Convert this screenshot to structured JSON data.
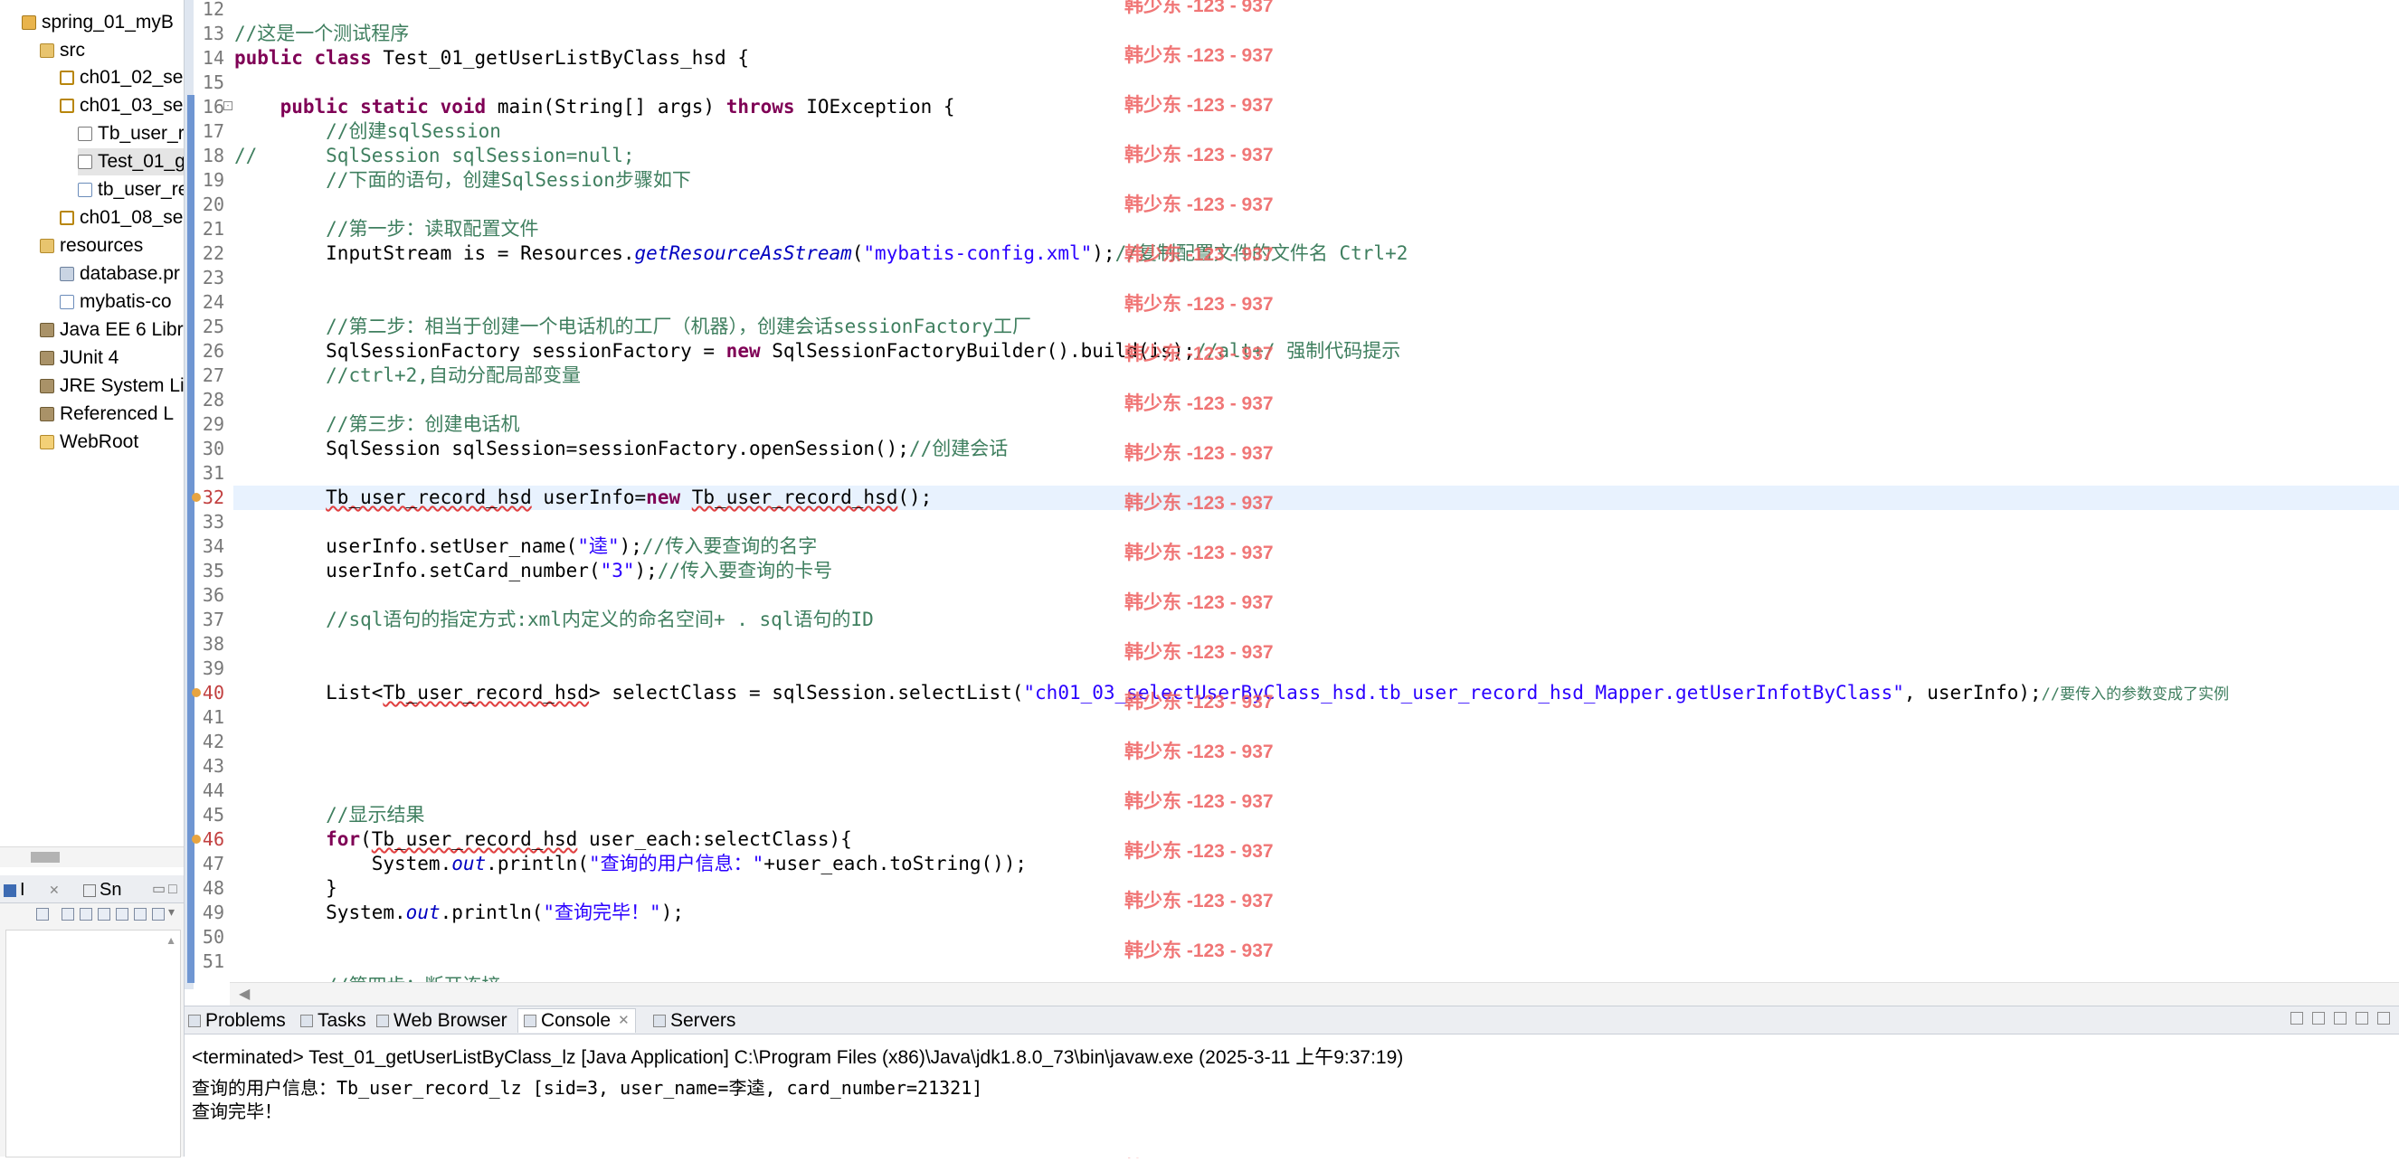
{
  "explorer": {
    "items": [
      {
        "label": "spring_01_myB",
        "icon": "project-icon"
      },
      {
        "label": "src",
        "icon": "folder-icon"
      },
      {
        "label": "ch01_02_se",
        "icon": "package-icon"
      },
      {
        "label": "ch01_03_se",
        "icon": "package-icon"
      },
      {
        "label": "Tb_user_r",
        "icon": "java-file-icon"
      },
      {
        "label": "Test_01_g",
        "icon": "java-file-icon"
      },
      {
        "label": "tb_user_re",
        "icon": "xml-file-icon"
      },
      {
        "label": "ch01_08_se",
        "icon": "package-icon"
      },
      {
        "label": "resources",
        "icon": "folder-icon"
      },
      {
        "label": "database.pr",
        "icon": "properties-file-icon"
      },
      {
        "label": "mybatis-co",
        "icon": "xml-file-icon"
      },
      {
        "label": "Java EE 6 Libr",
        "icon": "library-icon"
      },
      {
        "label": "JUnit 4",
        "icon": "library-icon"
      },
      {
        "label": "JRE System Li",
        "icon": "library-icon"
      },
      {
        "label": "Referenced L",
        "icon": "library-icon"
      },
      {
        "label": "WebRoot",
        "icon": "web-folder-icon"
      }
    ]
  },
  "lower_left": {
    "tab1": "I",
    "tab2": "Sn"
  },
  "editor": {
    "line_numbers": [
      "12",
      "13",
      "14",
      "15",
      "16",
      "17",
      "18",
      "19",
      "20",
      "21",
      "22",
      "23",
      "24",
      "25",
      "26",
      "27",
      "28",
      "29",
      "30",
      "31",
      "32",
      "33",
      "34",
      "35",
      "36",
      "37",
      "38",
      "39",
      "40",
      "41",
      "42",
      "43",
      "44",
      "45",
      "46",
      "47",
      "48",
      "49",
      "50",
      "51"
    ],
    "c13": "//这是一个测试程序",
    "c14_kw1": "public",
    "c14_kw2": "class",
    "c14_rest": " Test_01_getUserListByClass_hsd {",
    "c16_kw1": "public",
    "c16_kw2": "static",
    "c16_kw3": "void",
    "c16_mid": " main(String[] args) ",
    "c16_kw4": "throws",
    "c16_rest": " IOException {",
    "c17": "//创建sqlSession",
    "c18": "//      SqlSession sqlSession=null;",
    "c19": "//下面的语句，创建SqlSession步骤如下",
    "c21": "//第一步：读取配置文件",
    "c22_a": "InputStream is = Resources.",
    "c22_it": "getResourceAsStream",
    "c22_b": "(",
    "c22_str": "\"mybatis-config.xml\"",
    "c22_c": ");",
    "c22_cm": "//复制配置文件的文件名 Ctrl+2",
    "c25": "//第二步：相当于创建一个电话机的工厂（机器），创建会话sessionFactory工厂",
    "c26_a": "SqlSessionFactory sessionFactory = ",
    "c26_kw": "new",
    "c26_b": " SqlSessionFactoryBuilder().build(is);",
    "c26_cm": "//alt+/ 强制代码提示",
    "c27": "//ctrl+2,自动分配局部变量",
    "c29": "//第三步：创建电话机",
    "c30_a": "SqlSession sqlSession=sessionFactory.openSession();",
    "c30_cm": "//创建会话",
    "c32_a": "Tb_user_record_hsd",
    "c32_b": " userInfo=",
    "c32_kw": "new",
    "c32_c": " ",
    "c32_d": "Tb_user_record_hsd",
    "c32_e": "();",
    "c34_a": "userInfo.setUser_name(",
    "c34_str": "\"逵\"",
    "c34_b": ");",
    "c34_cm": "//传入要查询的名字",
    "c35_a": "userInfo.setCard_number(",
    "c35_str": "\"3\"",
    "c35_b": ");",
    "c35_cm": "//传入要查询的卡号",
    "c37": "//sql语句的指定方式:xml内定义的命名空间+ . sql语句的ID",
    "c40_a": "List<",
    "c40_b": "Tb_user_record_hsd",
    "c40_c": "> selectClass = sqlSession.selectList(",
    "c40_str": "\"ch01_03_selectUserByClass_hsd.tb_user_record_hsd_Mapper.getUserInfotByClass\"",
    "c40_d": ", userInfo);",
    "c40_cm": "//要传入的参数变成了实例",
    "c45": "//显示结果",
    "c46_kw": "for",
    "c46_a": "(",
    "c46_b": "Tb_user_record_hsd",
    "c46_c": " user_each:selectClass){",
    "c47_a": "System.",
    "c47_it": "out",
    "c47_b": ".println(",
    "c47_str": "\"查询的用户信息：\"",
    "c47_c": "+user_each.toString());",
    "c48": "}",
    "c49_a": "System.",
    "c49_it": "out",
    "c49_b": ".println(",
    "c49_str": "\"查询完毕！\"",
    "c49_c": ");",
    "c52": "//第四步：断开连接"
  },
  "watermark": {
    "text": "韩少东 -123 - 937"
  },
  "console": {
    "tabs": [
      {
        "label": "Problems",
        "icon": "problems-icon"
      },
      {
        "label": "Tasks",
        "icon": "tasks-icon"
      },
      {
        "label": "Web Browser",
        "icon": "web-browser-icon"
      },
      {
        "label": "Console",
        "icon": "console-icon"
      },
      {
        "label": "Servers",
        "icon": "servers-icon"
      }
    ],
    "close_glyph": "✕",
    "header": "<terminated> Test_01_getUserListByClass_lz [Java Application] C:\\Program Files (x86)\\Java\\jdk1.8.0_73\\bin\\javaw.exe (2025-3-11 上午9:37:19)",
    "lines": [
      "查询的用户信息：Tb_user_record_lz [sid=3, user_name=李逵, card_number=21321]",
      "查询完毕！"
    ]
  }
}
